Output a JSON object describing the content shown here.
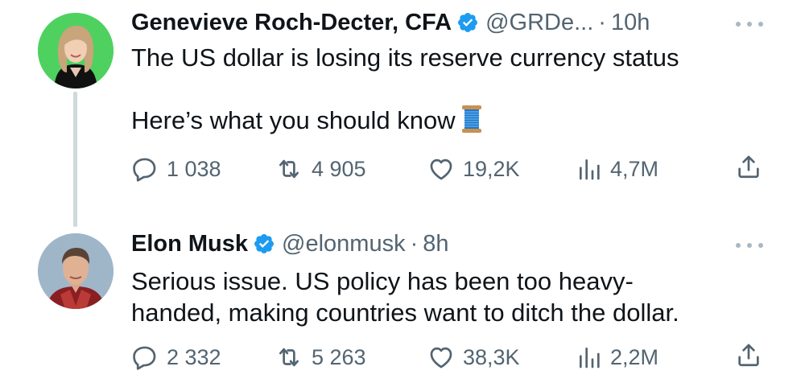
{
  "tweets": [
    {
      "author_name": "Genevieve Roch-Decter, CFA",
      "handle": "@GRDe...",
      "sep": "·",
      "time": "10h",
      "text_line1": "The US dollar is losing its reserve currency status",
      "text_line2": "Here’s what you should know",
      "emoji": "thread-spool",
      "replies": "1 038",
      "retweets": "4 905",
      "likes": "19,2K",
      "views": "4,7M",
      "avatar_bg": "#4fd160"
    },
    {
      "author_name": "Elon Musk",
      "handle": "@elonmusk",
      "sep": "·",
      "time": "8h",
      "text_line1": "Serious issue. US policy has been too heavy-",
      "text_line2": "handed, making countries want to ditch the dollar.",
      "replies": "2 332",
      "retweets": "5 263",
      "likes": "38,3K",
      "views": "2,2M",
      "avatar_bg": "#9fb6c9"
    }
  ],
  "icons": {
    "verified": "verified-badge-icon",
    "more": "more-icon",
    "reply": "reply-icon",
    "retweet": "retweet-icon",
    "like": "heart-icon",
    "views": "views-icon",
    "share": "share-icon"
  },
  "colors": {
    "verified_blue": "#1d9bf0",
    "secondary_text": "#536471",
    "primary_text": "#0f1419",
    "thread_line": "#cfd9de"
  }
}
